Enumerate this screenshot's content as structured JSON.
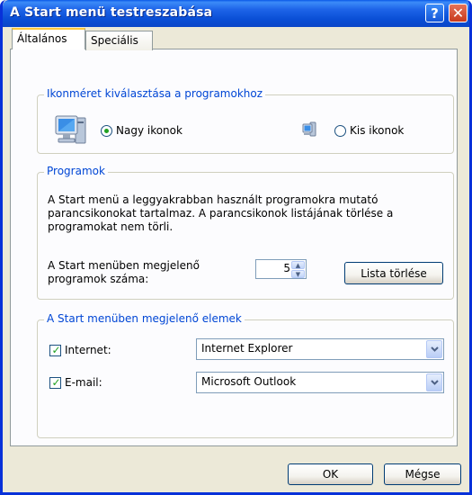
{
  "window": {
    "title": "A Start menü testreszabása",
    "help_glyph": "?",
    "close_glyph": "✕"
  },
  "tabs": [
    {
      "label": "Általános",
      "active": true
    },
    {
      "label": "Speciális",
      "active": false
    }
  ],
  "icon_size_group": {
    "title": "Ikonméret kiválasztása a programokhoz",
    "large": {
      "label": "Nagy ikonok",
      "selected": true,
      "icon": "large-computer-icon"
    },
    "small": {
      "label": "Kis ikonok",
      "selected": false,
      "icon": "small-computer-icon"
    }
  },
  "programs_group": {
    "title": "Programok",
    "description_lines": [
      "A Start menü a leggyakrabban használt programokra mutató",
      "parancsikonokat tartalmaz.  A parancsikonok listájának törlése a",
      "programokat nem törli."
    ],
    "count_label_line1": "A Start menüben megjelenő",
    "count_label_line2": "programok száma:",
    "count_value": "5",
    "clear_button": "Lista törlése"
  },
  "items_group": {
    "title": "A Start menüben megjelenő elemek",
    "internet": {
      "label": "Internet:",
      "checked": true,
      "value": "Internet Explorer"
    },
    "email": {
      "label": "E-mail:",
      "checked": true,
      "value": "Microsoft Outlook"
    }
  },
  "buttons": {
    "ok": "OK",
    "cancel": "Mégse"
  },
  "colors": {
    "titlebar": "#0A4FD6",
    "group_title": "#0046D5",
    "check": "#21A121"
  }
}
